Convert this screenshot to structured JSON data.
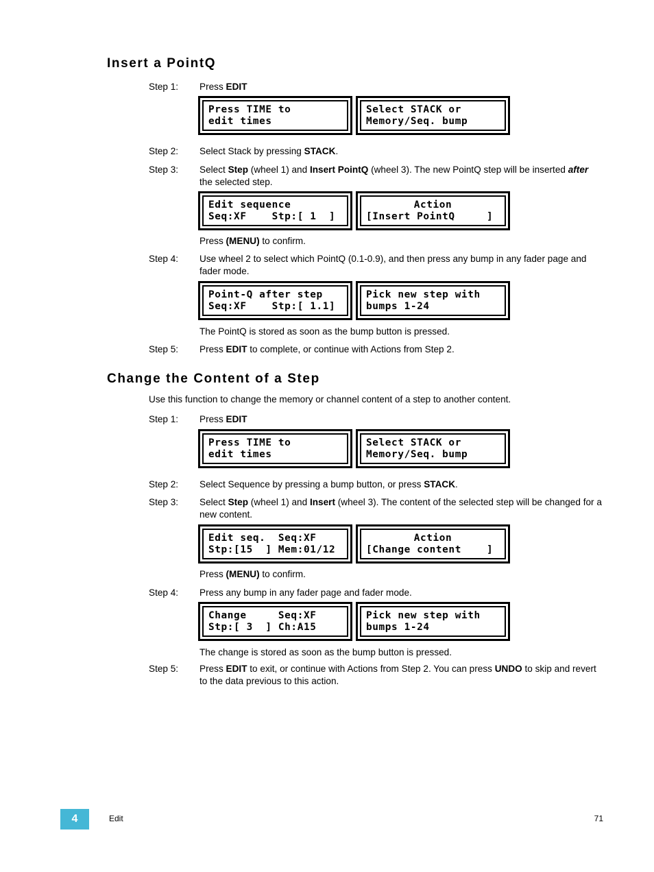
{
  "document": {
    "sections": [
      {
        "id": "insert-a-pointq",
        "heading": "Insert a PointQ"
      },
      {
        "id": "change-the-content-of-a-step",
        "heading": "Change the Content of a Step",
        "intro": "Use this function to change the memory or channel content of a step to another content."
      }
    ]
  },
  "section1": {
    "heading": "Insert a PointQ",
    "step1": {
      "label": "Step 1:",
      "text_pre": "Press ",
      "text_bold": "EDIT",
      "text_post": ""
    },
    "step2": {
      "label": "Step 2:",
      "text_pre": "Select Stack by pressing ",
      "text_bold": "STACK",
      "text_post": "."
    },
    "step3": {
      "label": "Step 3:",
      "p1": "Select ",
      "b1": "Step",
      "p2": " (wheel 1) and ",
      "b2": "Insert PointQ",
      "p3": " (wheel 3). The new PointQ step will be inserted ",
      "bi1": "after",
      "p4": " the selected step."
    },
    "menu_confirm": {
      "pre": "Press ",
      "bold": "(MENU)",
      "post": " to confirm."
    },
    "step4": {
      "label": "Step 4:",
      "text": "Use wheel 2 to select which PointQ (0.1-0.9), and then press any bump in any fader page and fader mode."
    },
    "stored_note": "The PointQ is stored as soon as the bump button is pressed.",
    "step5": {
      "label": "Step 5:",
      "p1": "Press ",
      "b1": "EDIT",
      "p2": " to complete, or continue with Actions from Step 2."
    },
    "lcd_row1": {
      "left": {
        "line1": "Press TIME to",
        "line2": "edit times"
      },
      "right": {
        "line1": "Select STACK or",
        "line2": "Memory/Seq. bump"
      }
    },
    "lcd_row2": {
      "left": {
        "line1": "Edit sequence",
        "line2": "Seq:XF    Stp:[ 1  ]"
      },
      "right": {
        "line1": "Action",
        "line2": "[Insert PointQ     ]"
      }
    },
    "lcd_row3": {
      "left": {
        "line1": "Point-Q after step",
        "line2": "Seq:XF    Stp:[ 1.1]"
      },
      "right": {
        "line1": "Pick new step with",
        "line2": "bumps 1-24"
      }
    }
  },
  "section2": {
    "heading": "Change the Content of a Step",
    "intro": "Use this function to change the memory or channel content of a step to another content.",
    "step1": {
      "label": "Step 1:",
      "text_pre": "Press ",
      "text_bold": "EDIT",
      "text_post": ""
    },
    "step2": {
      "label": "Step 2:",
      "text_pre": "Select Sequence by pressing a bump button, or press ",
      "text_bold": "STACK",
      "text_post": "."
    },
    "step3": {
      "label": "Step 3:",
      "p1": "Select ",
      "b1": "Step",
      "p2": " (wheel 1) and ",
      "b2": "Insert",
      "p3": " (wheel 3). The content of the selected step will be changed for a new content."
    },
    "menu_confirm": {
      "pre": "Press ",
      "bold": "(MENU)",
      "post": " to confirm."
    },
    "step4": {
      "label": "Step 4:",
      "text": "Press any bump in any fader page and fader mode."
    },
    "stored_note": "The change is stored as soon as the bump button is pressed.",
    "step5": {
      "label": "Step 5:",
      "p1": "Press ",
      "b1": "EDIT",
      "p2": " to exit, or continue with Actions from Step 2. You can press ",
      "b2": "UNDO",
      "p3": " to skip and revert to the data previous to this action."
    },
    "lcd_row1": {
      "left": {
        "line1": "Press TIME to",
        "line2": "edit times"
      },
      "right": {
        "line1": "Select STACK or",
        "line2": "Memory/Seq. bump"
      }
    },
    "lcd_row2": {
      "left": {
        "line1": "Edit seq.  Seq:XF",
        "line2": "Stp:[15  ] Mem:01/12"
      },
      "right": {
        "line1": "Action",
        "line2": "[Change content    ]"
      }
    },
    "lcd_row3": {
      "left": {
        "line1": "Change     Seq:XF",
        "line2": "Stp:[ 3  ] Ch:A15"
      },
      "right": {
        "line1": "Pick new step with",
        "line2": "bumps 1-24"
      }
    }
  },
  "footer": {
    "chapter_number": "4",
    "chapter_name": "Edit",
    "page_number": "71",
    "badge_color": "#45b7d6"
  }
}
